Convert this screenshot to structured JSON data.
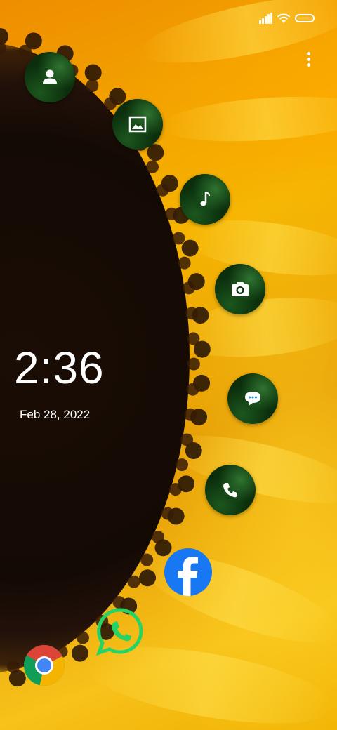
{
  "status_bar": {
    "signal_icon": "cellular-signal-icon",
    "wifi_icon": "wifi-icon",
    "battery_icon": "battery-icon"
  },
  "overflow_menu": {
    "icon": "more-vertical-icon"
  },
  "lock_clock": {
    "time": "2:36",
    "date": "Feb 28, 2022"
  },
  "arc_shortcuts": [
    {
      "name": "contacts",
      "icon": "contact-icon"
    },
    {
      "name": "gallery",
      "icon": "image-icon"
    },
    {
      "name": "music",
      "icon": "music-note-icon"
    },
    {
      "name": "camera",
      "icon": "camera-icon"
    },
    {
      "name": "messages",
      "icon": "message-icon"
    },
    {
      "name": "phone",
      "icon": "phone-icon"
    }
  ],
  "apps": [
    {
      "name": "Facebook",
      "icon": "facebook-icon",
      "color": "#1877F2"
    },
    {
      "name": "WhatsApp",
      "icon": "whatsapp-icon",
      "color": "#25D366"
    },
    {
      "name": "Chrome",
      "icon": "chrome-icon"
    }
  ],
  "colors": {
    "bubble_bg": "#0b2f0d",
    "text": "#ffffff"
  }
}
